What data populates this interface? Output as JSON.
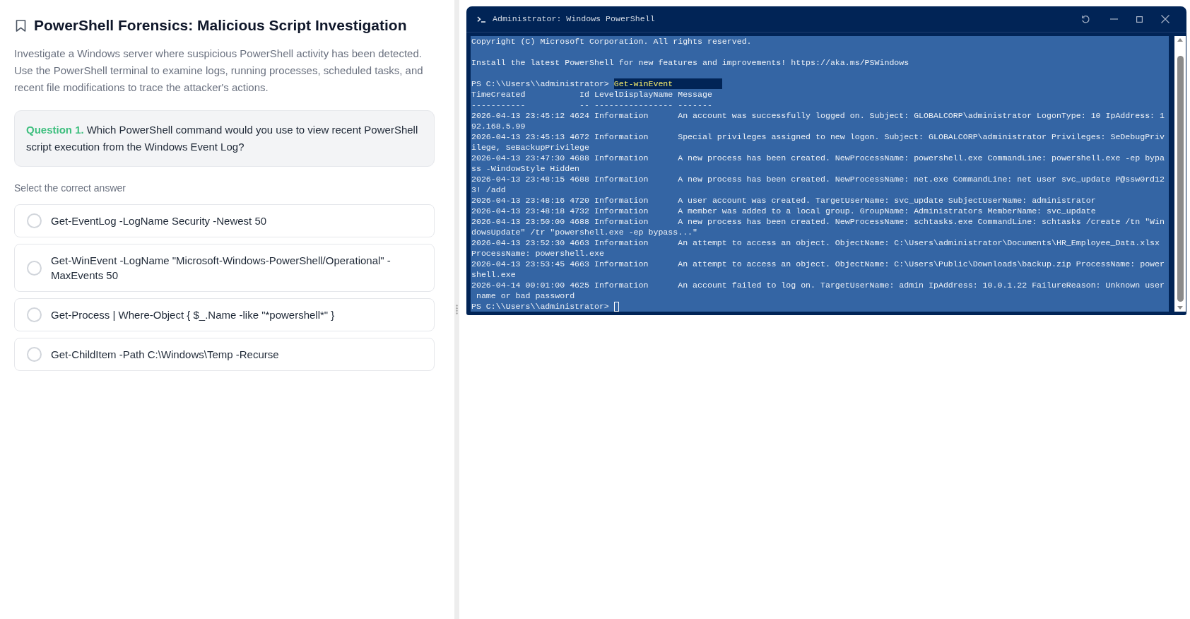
{
  "lesson": {
    "title": "PowerShell Forensics: Malicious Script Investigation",
    "description": "Investigate a Windows server where suspicious PowerShell activity has been detected. Use the PowerShell terminal to examine logs, running processes, scheduled tasks, and recent file modifications to trace the attacker's actions."
  },
  "question": {
    "label": "Question 1.",
    "text": "Which PowerShell command would you use to view recent PowerShell script execution from the Windows Event Log?"
  },
  "answers": {
    "instruction": "Select the correct answer",
    "options": [
      {
        "text": "Get-EventLog -LogName Security -Newest 50",
        "selected": false
      },
      {
        "text": "Get-WinEvent -LogName \"Microsoft-Windows-PowerShell/Operational\" -MaxEvents 50",
        "selected": false
      },
      {
        "text": "Get-Process | Where-Object { $_.Name -like \"*powershell*\" }",
        "selected": false
      },
      {
        "text": "Get-ChildItem -Path C:\\Windows\\Temp -Recurse",
        "selected": false
      }
    ]
  },
  "terminal": {
    "title": "Administrator: Windows PowerShell",
    "banner": [
      "Copyright (C) Microsoft Corporation. All rights reserved.",
      "Install the latest PowerShell for new features and improvements! https://aka.ms/PSWindows"
    ],
    "command": {
      "prompt": "PS C:\\\\Users\\\\administrator>",
      "input": "Get-winEvent"
    },
    "output": [
      "TimeCreated           Id LevelDisplayName Message",
      "-----------           -- ---------------- -------",
      "2026-04-13 23:45:12 4624 Information      An account was successfully logged on. Subject: GLOBALCORP\\administrator LogonType: 10 IpAddress: 1",
      "92.168.5.99",
      "2026-04-13 23:45:13 4672 Information      Special privileges assigned to new logon. Subject: GLOBALCORP\\administrator Privileges: SeDebugPriv",
      "ilege, SeBackupPrivilege",
      "2026-04-13 23:47:30 4688 Information      A new process has been created. NewProcessName: powershell.exe CommandLine: powershell.exe -ep bypa",
      "ss -WindowStyle Hidden",
      "2026-04-13 23:48:15 4688 Information      A new process has been created. NewProcessName: net.exe CommandLine: net user svc_update P@ssw0rd12",
      "3! /add",
      "2026-04-13 23:48:16 4720 Information      A user account was created. TargetUserName: svc_update SubjectUserName: administrator",
      "2026-04-13 23:48:18 4732 Information      A member was added to a local group. GroupName: Administrators MemberName: svc_update",
      "2026-04-13 23:50:00 4688 Information      A new process has been created. NewProcessName: schtasks.exe CommandLine: schtasks /create /tn \"Win",
      "dowsUpdate\" /tr \"powershell.exe -ep bypass...\"",
      "2026-04-13 23:52:30 4663 Information      An attempt to access an object. ObjectName: C:\\Users\\administrator\\Documents\\HR_Employee_Data.xlsx",
      "ProcessName: powershell.exe",
      "2026-04-13 23:53:45 4663 Information      An attempt to access an object. ObjectName: C:\\Users\\Public\\Downloads\\backup.zip ProcessName: power",
      "shell.exe",
      "2026-04-14 00:01:00 4625 Information      An account failed to log on. TargetUserName: admin IpAddress: 10.0.1.22 FailureReason: Unknown user",
      " name or bad password"
    ],
    "prompt": "PS C:\\\\Users\\\\administrator>"
  }
}
